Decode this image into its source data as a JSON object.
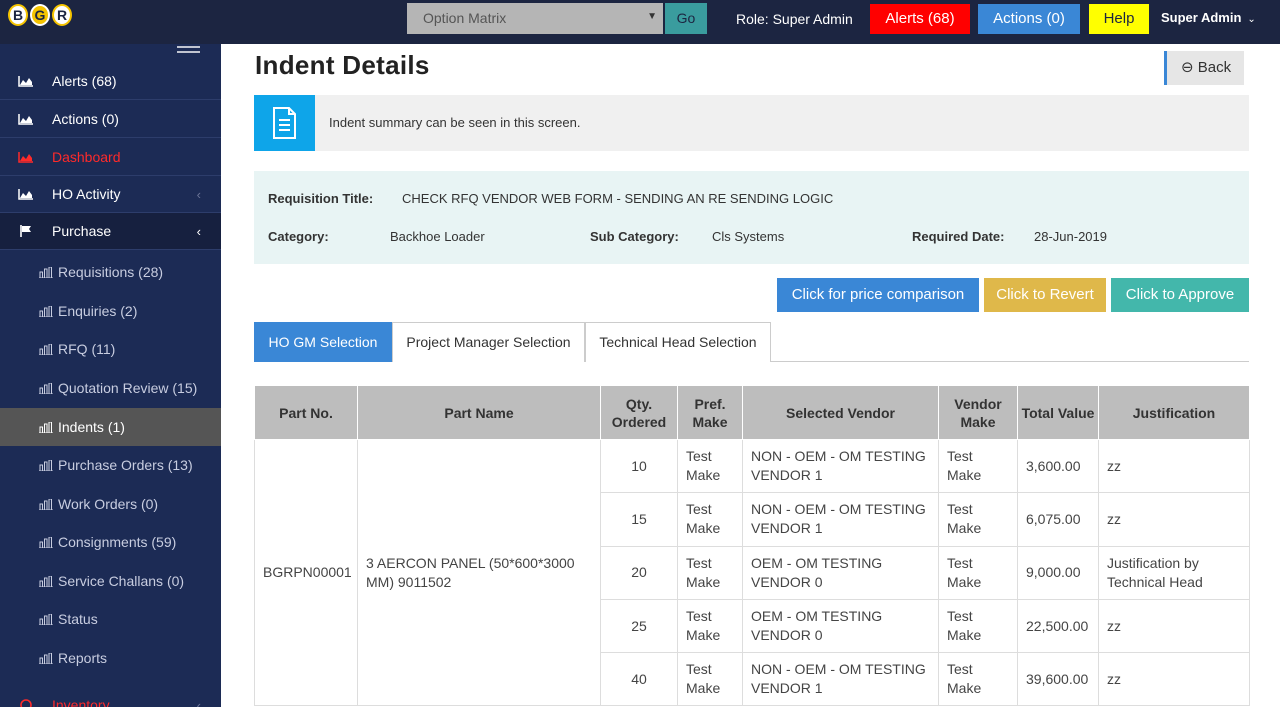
{
  "header": {
    "logo_letters": [
      "B",
      "G",
      "R"
    ],
    "option_select": "Option Matrix",
    "go_label": "Go",
    "role_text": "Role: Super Admin",
    "alerts_label": "Alerts (68)",
    "actions_label": "Actions (0)",
    "help_label": "Help",
    "user_label": "Super Admin"
  },
  "sidebar": {
    "top_items": [
      {
        "label": "Alerts (68)",
        "icon": "chart-area-icon"
      },
      {
        "label": "Actions (0)",
        "icon": "chart-area-icon"
      },
      {
        "label": "Dashboard",
        "icon": "chart-area-icon"
      },
      {
        "label": "HO Activity",
        "icon": "chart-area-icon"
      },
      {
        "label": "Purchase",
        "icon": "flag-icon"
      }
    ],
    "sub_items": [
      "Requisitions (28)",
      "Enquiries (2)",
      "RFQ (11)",
      "Quotation Review (15)",
      "Indents (1)",
      "Purchase Orders (13)",
      "Work Orders (0)",
      "Consignments (59)",
      "Service Challans (0)",
      "Status",
      "Reports"
    ],
    "bottom_item": "Inventory"
  },
  "main": {
    "title": "Indent Details",
    "back_label": "Back",
    "info_text": "Indent summary can be seen in this screen.",
    "requisition": {
      "title_label": "Requisition Title:",
      "title_value": "CHECK RFQ VENDOR WEB FORM - SENDING AN RE SENDING LOGIC",
      "category_label": "Category:",
      "category_value": "Backhoe Loader",
      "subcategory_label": "Sub Category:",
      "subcategory_value": "Cls Systems",
      "required_date_label": "Required Date:",
      "required_date_value": "28-Jun-2019"
    },
    "buttons": {
      "compare": "Click for price comparison",
      "revert": "Click to Revert",
      "approve": "Click to Approve"
    },
    "tabs": [
      "HO GM Selection",
      "Project Manager Selection",
      "Technical Head Selection"
    ],
    "table": {
      "headers": [
        "Part No.",
        "Part Name",
        "Qty. Ordered",
        "Pref. Make",
        "Selected Vendor",
        "Vendor Make",
        "Total Value",
        "Justification"
      ],
      "part_no": "BGRPN00001",
      "part_name": "3 AERCON PANEL (50*600*3000 MM) 9011502",
      "rows": [
        {
          "qty": "10",
          "pref_make": "Test Make",
          "vendor": "NON - OEM - OM TESTING VENDOR 1",
          "vendor_make": "Test Make",
          "total": "3,600.00",
          "justification": "zz"
        },
        {
          "qty": "15",
          "pref_make": "Test Make",
          "vendor": "NON - OEM - OM TESTING VENDOR 1",
          "vendor_make": "Test Make",
          "total": "6,075.00",
          "justification": "zz"
        },
        {
          "qty": "20",
          "pref_make": "Test Make",
          "vendor": "OEM - OM TESTING VENDOR 0",
          "vendor_make": "Test Make",
          "total": "9,000.00",
          "justification": "Justification by Technical Head"
        },
        {
          "qty": "25",
          "pref_make": "Test Make",
          "vendor": "OEM - OM TESTING VENDOR 0",
          "vendor_make": "Test Make",
          "total": "22,500.00",
          "justification": "zz"
        },
        {
          "qty": "40",
          "pref_make": "Test Make",
          "vendor": "NON - OEM - OM TESTING VENDOR 1",
          "vendor_make": "Test Make",
          "total": "39,600.00",
          "justification": "zz"
        }
      ]
    }
  }
}
